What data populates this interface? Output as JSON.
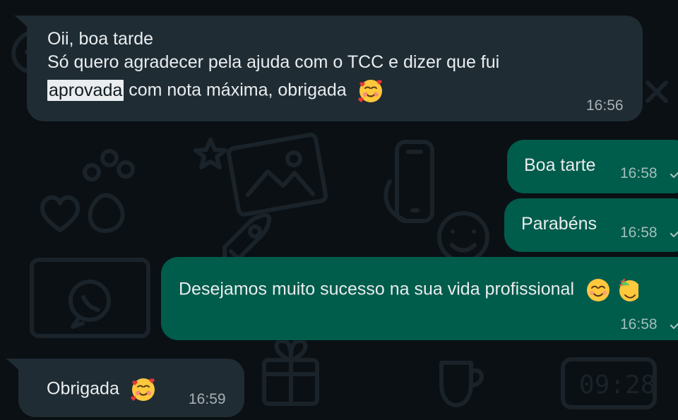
{
  "messages": [
    {
      "direction": "incoming",
      "line1": "Oii, boa tarde",
      "line2": "Só quero agradecer pela ajuda com o TCC e dizer que fui",
      "highlight": "aprovada",
      "line3_rest": "com nota máxima, obrigada",
      "emoji": "smiling-face-with-hearts-icon",
      "time": "16:56"
    },
    {
      "direction": "outgoing",
      "text": "Boa tarte",
      "time": "16:58",
      "status": "read"
    },
    {
      "direction": "outgoing",
      "text": "Parabéns",
      "time": "16:58",
      "status": "read"
    },
    {
      "direction": "outgoing",
      "text": "Desejamos muito sucesso na sua vida profissional",
      "emoji": [
        "smiling-face-with-smiling-eyes-icon",
        "partying-face-icon"
      ],
      "time": "16:58",
      "status": "read"
    },
    {
      "direction": "incoming",
      "text": "Obrigada",
      "emoji": "smiling-face-with-hearts-icon",
      "time": "16:59"
    }
  ],
  "theme": {
    "chat_background": "#0b1014",
    "incoming_bubble": "#1f2c34",
    "outgoing_bubble": "#005c4b",
    "text": "#e9edef"
  }
}
